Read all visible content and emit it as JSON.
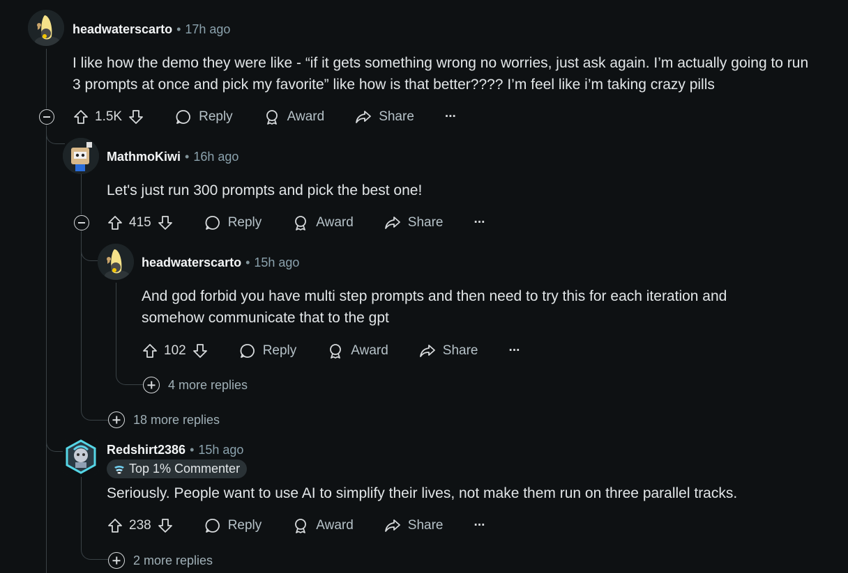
{
  "comments": [
    {
      "username": "headwaterscarto",
      "time": "17h ago",
      "text": "I like how the demo they were like - “if it gets something wrong no worries, just ask again. I’m actually going to run 3 prompts at once and pick my favorite” like how is that better???? I’m feel like i’m taking crazy pills",
      "votes": "1.5K"
    },
    {
      "username": "MathmoKiwi",
      "time": "16h ago",
      "text": "Let's just run 300 prompts and pick the best one!",
      "votes": "415"
    },
    {
      "username": "headwaterscarto",
      "time": "15h ago",
      "text": "And god forbid you have multi step prompts and then need to try this for each iteration and somehow communicate that to the gpt",
      "votes": "102",
      "more_replies": "4 more replies"
    },
    {
      "username": "Redshirt2386",
      "time": "15h ago",
      "flair": "Top 1% Commenter",
      "text": "Seriously. People want to use AI to simplify their lives, not make them run on three parallel tracks.",
      "votes": "238",
      "more_replies": "2 more replies"
    }
  ],
  "mathmo_more_replies": "18 more replies",
  "actions": {
    "reply": "Reply",
    "award": "Award",
    "share": "Share",
    "more": "···"
  },
  "separator": "•",
  "colors": {
    "background": "#0e1113",
    "thread_line": "#3a4246",
    "text": "#d7dadc"
  }
}
